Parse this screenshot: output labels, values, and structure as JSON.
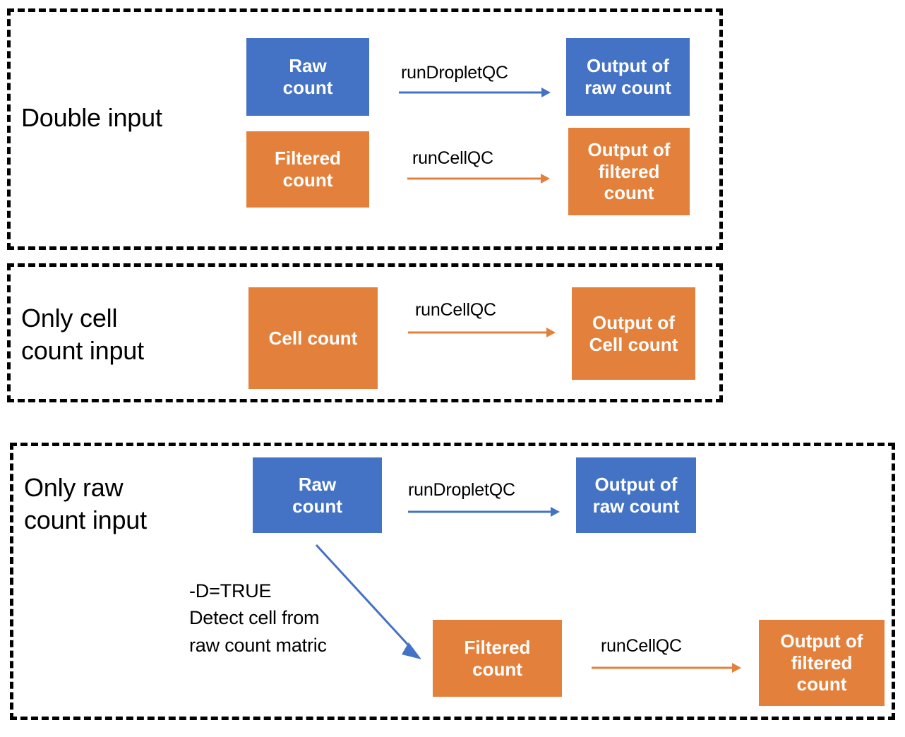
{
  "diagram": {
    "title_colors": {
      "blue": "#4472C4",
      "orange": "#E3813C",
      "border": "#000000",
      "text_on_node": "#FFFFFF",
      "label_text": "#000000"
    },
    "panels": [
      {
        "id": "double-input",
        "label": "Double input",
        "nodes": [
          {
            "id": "raw-count",
            "text": "Raw\ncount",
            "color": "blue"
          },
          {
            "id": "output-raw-count",
            "text": "Output of\nraw count",
            "color": "blue"
          },
          {
            "id": "filtered-count",
            "text": "Filtered\ncount",
            "color": "orange"
          },
          {
            "id": "output-filtered-count",
            "text": "Output of\nfiltered\ncount",
            "color": "orange"
          }
        ],
        "edges": [
          {
            "id": "raw-to-output",
            "label": "runDropletQC",
            "color": "blue"
          },
          {
            "id": "filtered-to-output",
            "label": "runCellQC",
            "color": "orange"
          }
        ]
      },
      {
        "id": "only-cell-count-input",
        "label": "Only cell\ncount input",
        "nodes": [
          {
            "id": "cell-count",
            "text": "Cell count",
            "color": "orange"
          },
          {
            "id": "output-cell-count",
            "text": "Output of\nCell count",
            "color": "orange"
          }
        ],
        "edges": [
          {
            "id": "cell-to-output",
            "label": "runCellQC",
            "color": "orange"
          }
        ]
      },
      {
        "id": "only-raw-count-input",
        "label": "Only raw\ncount input",
        "nodes": [
          {
            "id": "raw-count-2",
            "text": "Raw\ncount",
            "color": "blue"
          },
          {
            "id": "output-raw-count-2",
            "text": "Output of\nraw count",
            "color": "blue"
          },
          {
            "id": "filtered-count-2",
            "text": "Filtered\ncount",
            "color": "orange"
          },
          {
            "id": "output-filtered-count-2",
            "text": "Output of\nfiltered\ncount",
            "color": "orange"
          }
        ],
        "edges": [
          {
            "id": "raw-to-output-2",
            "label": "runDropletQC",
            "color": "blue"
          },
          {
            "id": "filtered-to-output-2",
            "label": "runCellQC",
            "color": "orange"
          },
          {
            "id": "raw-to-filtered",
            "label": "",
            "color": "blue"
          }
        ],
        "note": "-D=TRUE\nDetect cell from\nraw count matric"
      }
    ]
  }
}
